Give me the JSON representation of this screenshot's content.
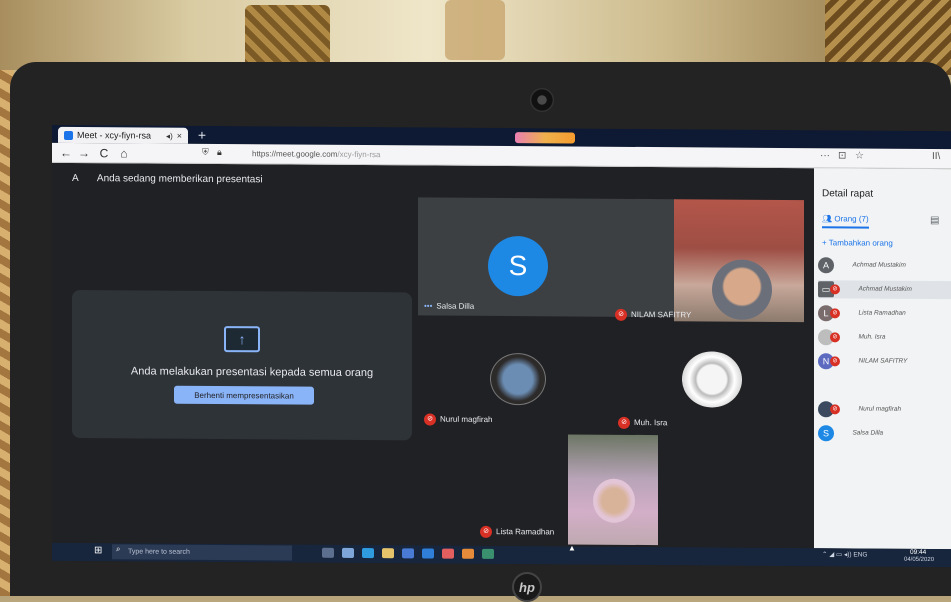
{
  "browser": {
    "tab_title": "Meet - xcy-fiyn-rsa",
    "tab_close": "×",
    "new_tab": "+",
    "url_domain": "https://meet.google.com",
    "url_path": "/xcy-fiyn-rsa",
    "nav": {
      "back": "←",
      "forward": "→",
      "reload": "C",
      "home": "⌂"
    },
    "more": "···",
    "pocket": "⊡",
    "star": "☆",
    "library": "II\\"
  },
  "meet": {
    "banner_letter": "A",
    "banner_text": "Anda sedang memberikan presentasi",
    "present_text": "Anda melakukan presentasi kepada semua orang",
    "stop_button": "Berhenti mempresentasikan",
    "tiles": [
      {
        "name": "Salsa Dilla",
        "avatar_letter": "S"
      },
      {
        "name": "NILAM SAFITRY"
      },
      {
        "name": "Nurul magfirah"
      },
      {
        "name": "Muh. Isra"
      },
      {
        "name": "Lista Ramadhan"
      }
    ]
  },
  "panel": {
    "title": "Detail rapat",
    "tab_people": "Orang (7)",
    "add_people": "Tambahkan orang",
    "people": [
      {
        "name": "Achmad Mustakim",
        "avatar": "A",
        "color": "#5f6368"
      },
      {
        "name": "Achmad Mustakim",
        "avatar": "",
        "color": "#5f6368"
      },
      {
        "name": "Lista Ramadhan",
        "avatar": "L",
        "color": "#7a6c6c"
      },
      {
        "name": "Muh. Isra",
        "avatar": "",
        "color": "#bdbdbd"
      },
      {
        "name": "NILAM SAFITRY",
        "avatar": "N",
        "color": "#5c6bc0"
      },
      {
        "name": "Nurul magfirah",
        "avatar": "",
        "color": "#3b4a5e"
      },
      {
        "name": "Salsa Dilla",
        "avatar": "S",
        "color": "#1e88e5"
      }
    ]
  },
  "taskbar": {
    "search_placeholder": "Type here to search",
    "time": "09:44",
    "date": "04/05/2020",
    "tray": "ENG"
  },
  "laptop": {
    "brand": "hp"
  },
  "colors": {
    "meet_blue": "#8ab4f8",
    "muted_red": "#d93025",
    "taskbar": "#17263d"
  }
}
